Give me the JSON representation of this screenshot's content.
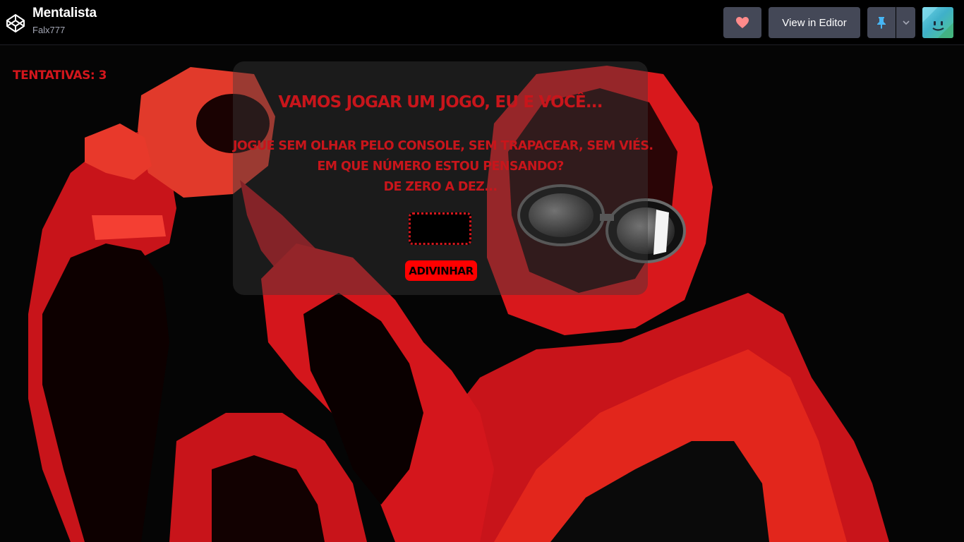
{
  "header": {
    "title": "Mentalista",
    "author": "Falx777",
    "like_icon": "heart-icon",
    "editor_label": "View in Editor",
    "pin_icon": "pin-icon",
    "dropdown_icon": "chevron-down-icon",
    "logo_icon": "codepen-logo-icon"
  },
  "game": {
    "attempts": "TENTATIVAS: 3",
    "headline": "VAMOS JOGAR UM JOGO, EU E VOCÊ...",
    "prompt": [
      "JOGUE SEM OLHAR PELO CONSOLE, SEM TRAPACEAR, SEM VIÉS.",
      "EM QUE NÚMERO ESTOU PENSANDO?",
      "DE ZERO A DEZ..."
    ],
    "guess_value": "",
    "button_label": "ADIVINHAR"
  },
  "colors": {
    "accent_red": "#d4161c",
    "button_red": "#ff0000",
    "topbar_bg": "#000000",
    "button_bg": "#444857",
    "heart": "#ff8b8b"
  }
}
